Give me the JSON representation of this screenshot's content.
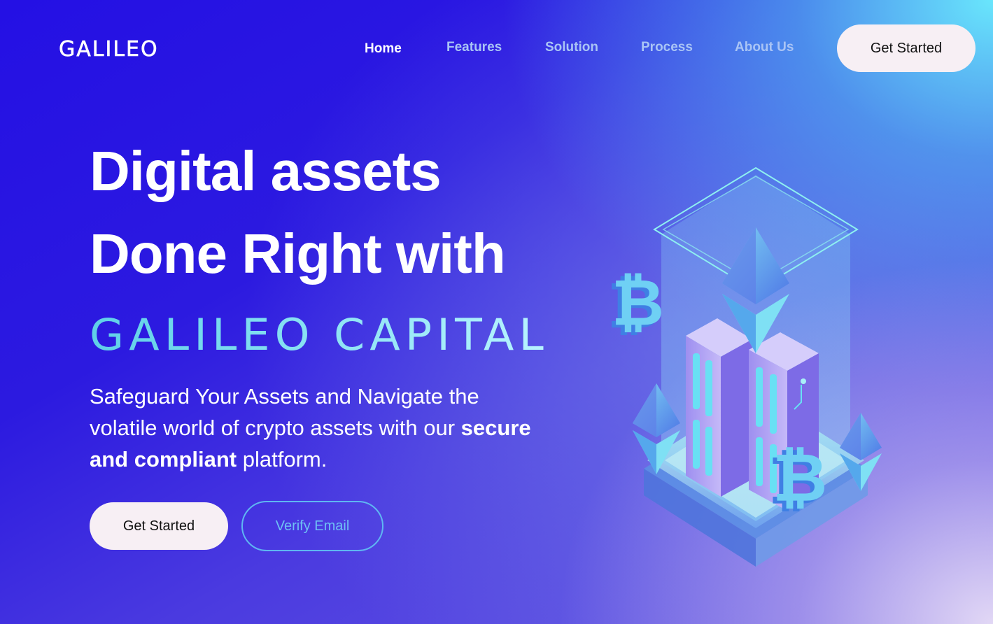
{
  "header": {
    "logo_text": "GALILEO",
    "nav": [
      {
        "label": "Home",
        "active": true
      },
      {
        "label": "Features",
        "active": false
      },
      {
        "label": "Solution",
        "active": false
      },
      {
        "label": "Process",
        "active": false
      },
      {
        "label": "About Us",
        "active": false
      }
    ],
    "cta_label": "Get Started"
  },
  "hero": {
    "title_line1": "Digital assets",
    "title_line2": "Done Right with",
    "brand_text": "GALILEO CAPITAL",
    "subtitle_pre": "Safeguard Your Assets and Navigate the volatile world of crypto assets with our ",
    "subtitle_bold": "secure and compliant",
    "subtitle_post": " platform.",
    "primary_button": "Get Started",
    "secondary_button": "Verify Email"
  },
  "illustration": {
    "icons": [
      "bitcoin-icon",
      "ethereum-icon",
      "server-rack-icon"
    ]
  },
  "colors": {
    "background_start": "#2410e4",
    "background_corner": "#69e6fc",
    "button_bg": "#f7eff4",
    "outline_button": "#5fb6f2",
    "nav_inactive": "#a9c4f5",
    "brand_gradient_start": "#5fd0e8",
    "brand_gradient_end": "#b8f4ff"
  }
}
